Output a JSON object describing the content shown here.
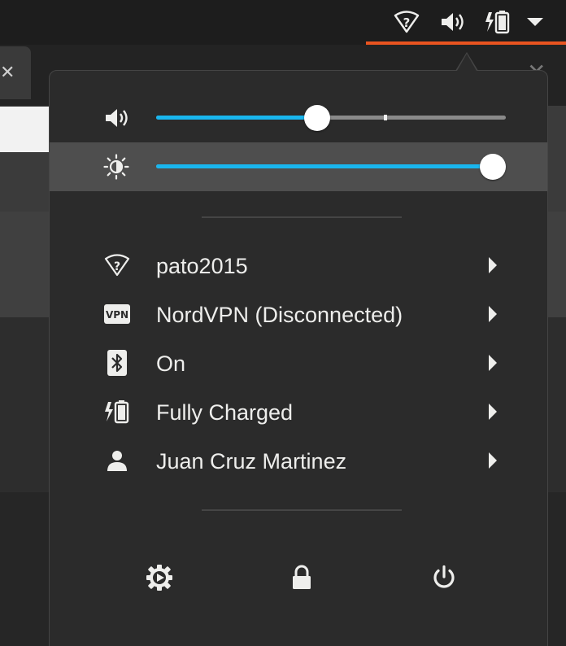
{
  "topbar": {
    "icons": [
      "wifi-question-icon",
      "volume-icon",
      "battery-charging-icon",
      "menu-dropdown-icon"
    ],
    "indicator_color": "#e95420"
  },
  "sliders": {
    "volume": {
      "icon": "volume-icon",
      "level": 0.46,
      "overamp_mark": 0.65
    },
    "brightness": {
      "icon": "brightness-icon",
      "level": 1.0
    }
  },
  "menu": {
    "items": [
      {
        "icon": "wifi-question-icon",
        "label": "pato2015"
      },
      {
        "icon": "vpn-icon",
        "label": "NordVPN (Disconnected)",
        "icon_text": "VPN"
      },
      {
        "icon": "bluetooth-icon",
        "label": "On"
      },
      {
        "icon": "battery-charging-icon",
        "label": "Fully Charged"
      },
      {
        "icon": "user-icon",
        "label": "Juan Cruz Martinez"
      }
    ],
    "actions": [
      "settings-icon",
      "lock-icon",
      "power-icon"
    ]
  },
  "colors": {
    "accent": "#19b6ee",
    "panel": "#2b2b2b",
    "highlight": "#4e4e4e"
  }
}
